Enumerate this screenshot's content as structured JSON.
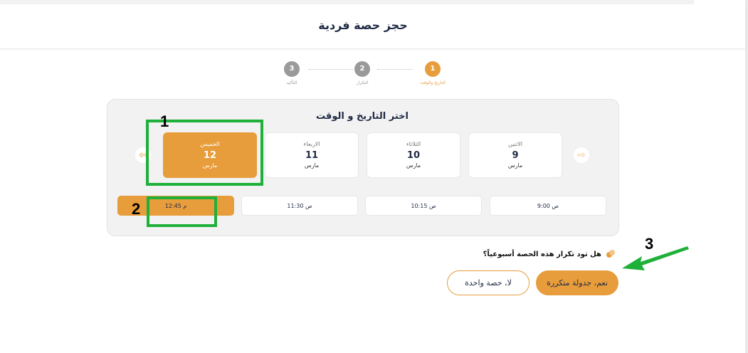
{
  "header": {
    "title": "حجز حصة فردية"
  },
  "stepper": [
    {
      "number": "1",
      "label": "التاريخ والوقت",
      "state": "active"
    },
    {
      "number": "2",
      "label": "التكرار",
      "state": "todo"
    },
    {
      "number": "3",
      "label": "التأكيد",
      "state": "todo"
    }
  ],
  "panel": {
    "title": "اختر التاريخ و الوقت",
    "days": [
      {
        "name": "الاثنين",
        "day": "9",
        "month": "مارس",
        "selected": false
      },
      {
        "name": "الثلاثاء",
        "day": "10",
        "month": "مارس",
        "selected": false
      },
      {
        "name": "الاربعاء",
        "day": "11",
        "month": "مارس",
        "selected": false
      },
      {
        "name": "الخميس",
        "day": "12",
        "month": "مارس",
        "selected": true
      }
    ],
    "times": [
      {
        "label": "9:00 ص",
        "selected": false
      },
      {
        "label": "10:15 ص",
        "selected": false
      },
      {
        "label": "11:30 ص",
        "selected": false
      },
      {
        "label": "12:45 م",
        "selected": true
      }
    ],
    "icons": {
      "next": "arrow-right-icon",
      "prev": "arrow-left-icon"
    }
  },
  "recurrence": {
    "question": "هل تود تكرار هذه الحصة أسبوعياً؟",
    "yes_label": "نعم، جدولة متكررة",
    "no_label": "لا، حصة واحدة"
  },
  "annotations": [
    "1",
    "2",
    "3"
  ],
  "colors": {
    "accent": "#e89d3c",
    "annotation": "#1fb03a",
    "text": "#1f2a44"
  }
}
